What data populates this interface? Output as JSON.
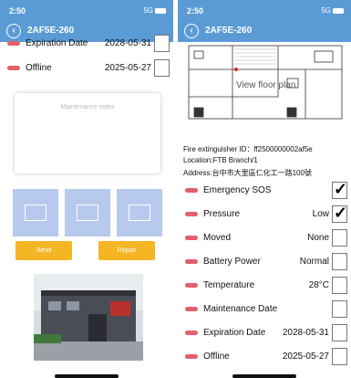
{
  "left": {
    "status": {
      "time": "2:50",
      "signal": "5G"
    },
    "header": {
      "title": "2AF5E-260"
    },
    "rows": [
      {
        "label": "Expiration Date",
        "value": "2028-05-31"
      },
      {
        "label": "Offline",
        "value": "2025-05-27"
      }
    ],
    "notes_placeholder": "Maintenance notes",
    "buttons": {
      "send": "Send",
      "repair": "Repair"
    }
  },
  "right": {
    "status": {
      "time": "2:50",
      "signal": "5G"
    },
    "header": {
      "title": "2AF5E-260"
    },
    "floorplan_label": "View floor plan",
    "info": {
      "id": "Fire extinguisher ID：ff2500000002af5e",
      "location": "Location:FTB Branch/1",
      "address": "Address:台中市大里區仁化工一路100號"
    },
    "rows": [
      {
        "label": "Emergency SOS",
        "value": "",
        "checked": true
      },
      {
        "label": "Pressure",
        "value": "Low",
        "checked": true
      },
      {
        "label": "Moved",
        "value": "None",
        "checked": false
      },
      {
        "label": "Battery Power",
        "value": "Normal",
        "checked": false
      },
      {
        "label": "Temperature",
        "value": "28°C",
        "checked": false
      },
      {
        "label": "Maintenance Date",
        "value": "",
        "checked": false
      },
      {
        "label": "Expiration Date",
        "value": "2028-05-31",
        "checked": false
      },
      {
        "label": "Offline",
        "value": "2025-05-27",
        "checked": false
      }
    ]
  },
  "colors": {
    "header": "#5b9bd5",
    "pill": "#e26068",
    "button": "#f5b625",
    "thumb": "#b7c9ec"
  }
}
